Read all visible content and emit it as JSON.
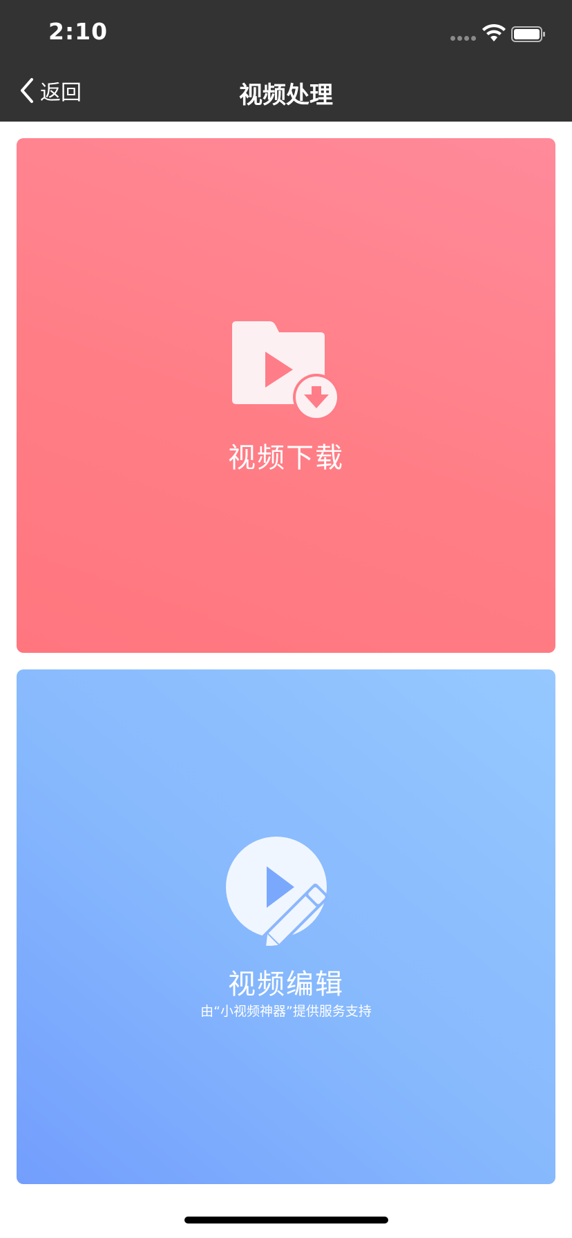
{
  "status_bar": {
    "time": "2:10"
  },
  "nav": {
    "back_label": "返回",
    "title": "视频处理"
  },
  "cards": [
    {
      "title": "视频下载",
      "icon": "folder-video-download-icon",
      "colors": [
        "#ff8a9a",
        "#ff767f"
      ]
    },
    {
      "title": "视频编辑",
      "subtitle": "由“小视频神器”提供服务支持",
      "icon": "video-edit-icon",
      "colors": [
        "#739efd",
        "#96c8ff"
      ]
    }
  ],
  "colors": {
    "bar_background": "#333333",
    "page_background": "#ffffff",
    "icon_fill": "#fdf0f2",
    "icon_fill_blue": "#f0f6ff"
  }
}
